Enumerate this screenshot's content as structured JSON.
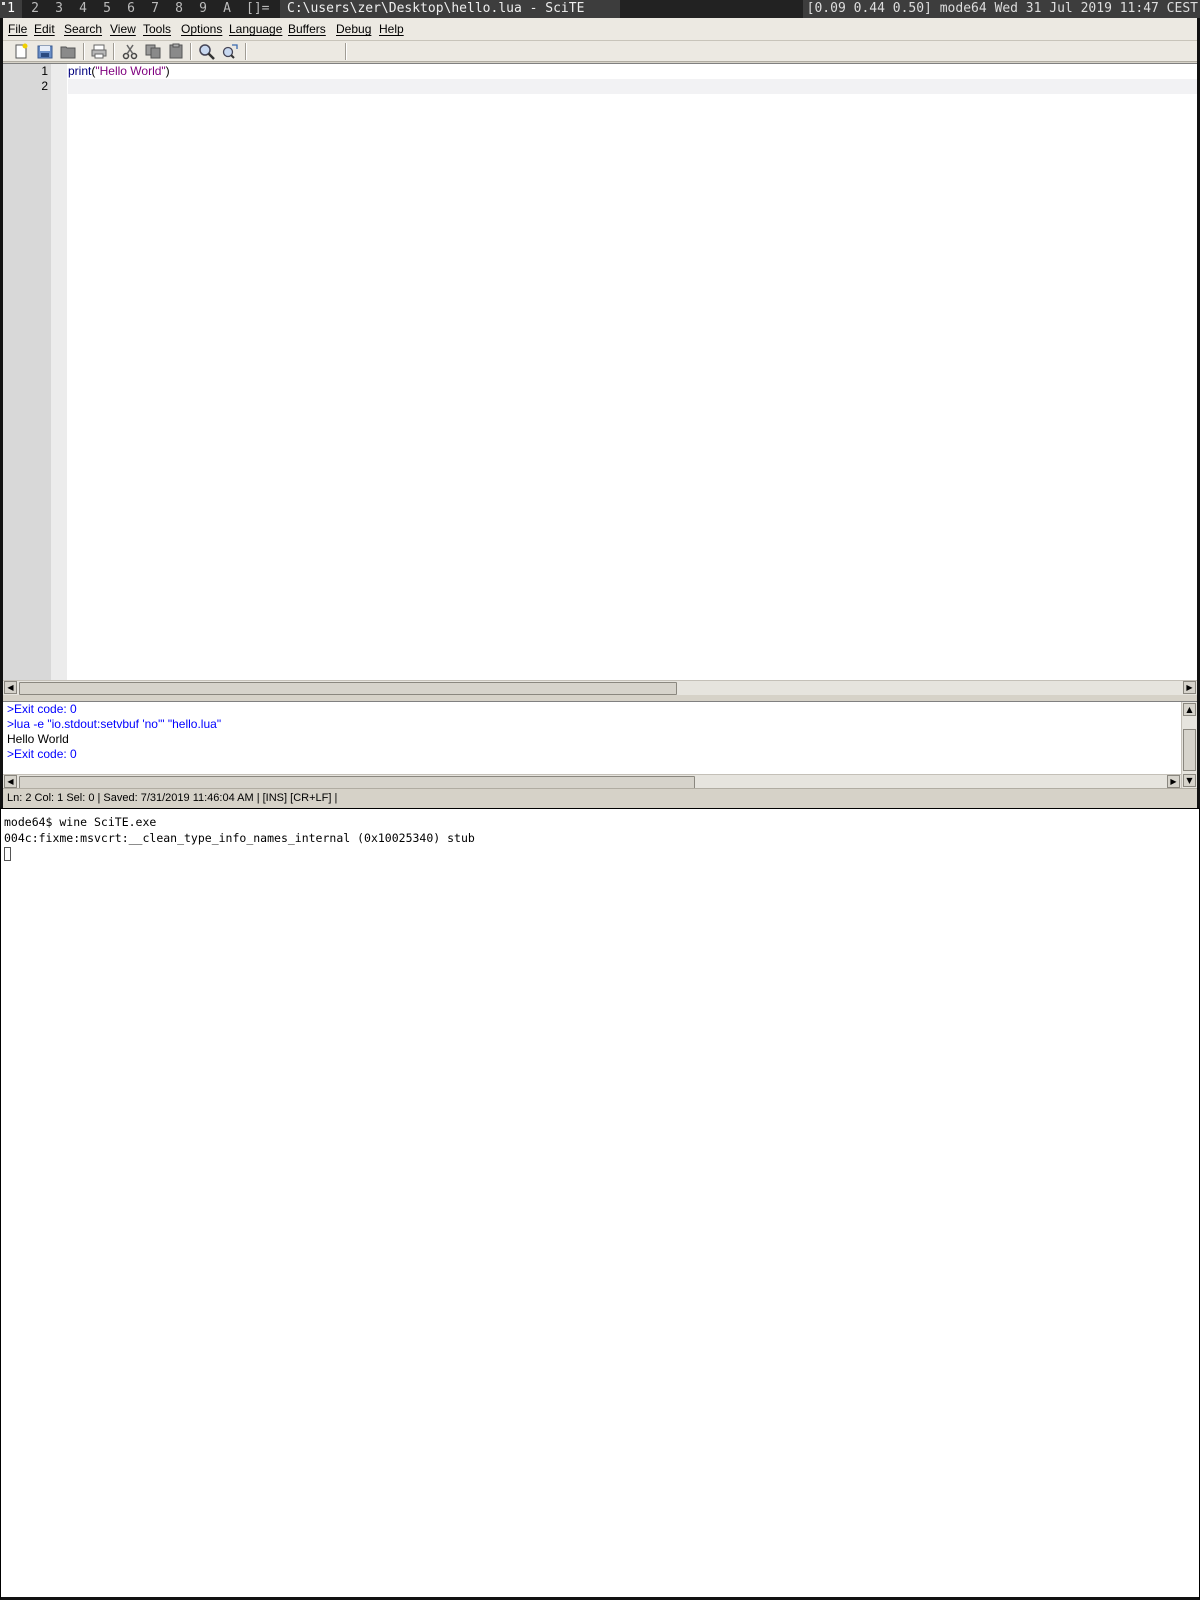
{
  "wm": {
    "workspaces": [
      "1",
      "2",
      "3",
      "4",
      "5",
      "6",
      "7",
      "8",
      "9",
      "A"
    ],
    "active_workspace": "1",
    "layout_symbol": "[]=",
    "window_title": "C:\\users\\zer\\Desktop\\hello.lua - SciTE",
    "status": "[0.09 0.44 0.50] mode64 Wed 31 Jul 2019 11:47 CEST"
  },
  "menu": {
    "items": [
      "File",
      "Edit",
      "Search",
      "View",
      "Tools",
      "Options",
      "Language",
      "Buffers",
      "Debug",
      "Help"
    ]
  },
  "toolbar": {
    "icons": [
      "new-file-icon",
      "open-file-icon",
      "save-file-icon",
      "print-icon",
      "cut-icon",
      "copy-icon",
      "paste-icon",
      "find-icon",
      "replace-icon"
    ]
  },
  "editor": {
    "line_numbers": [
      "1",
      "2"
    ],
    "code": {
      "fn": "print",
      "open": "(",
      "str": "\"Hello World\"",
      "close": ")"
    }
  },
  "output": {
    "lines": [
      {
        "text": ">Exit code: 0",
        "kind": "cmd"
      },
      {
        "text": ">lua -e \"io.stdout:setvbuf 'no'\" \"hello.lua\"",
        "kind": "cmd"
      },
      {
        "text": "Hello World",
        "kind": "text"
      },
      {
        "text": ">Exit code: 0",
        "kind": "cmd"
      }
    ]
  },
  "statusbar": {
    "text": "Ln: 2 Col: 1 Sel: 0  |  Saved: 7/31/2019  11:46:04 AM  |  [INS]  [CR+LF]  |"
  },
  "terminal": {
    "lines": [
      "mode64$ wine SciTE.exe",
      "004c:fixme:msvcrt:__clean_type_info_names_internal (0x10025340) stub"
    ]
  },
  "colors": {
    "keyword": "#00007f",
    "string": "#7f007f",
    "output_command": "#0000ff"
  }
}
